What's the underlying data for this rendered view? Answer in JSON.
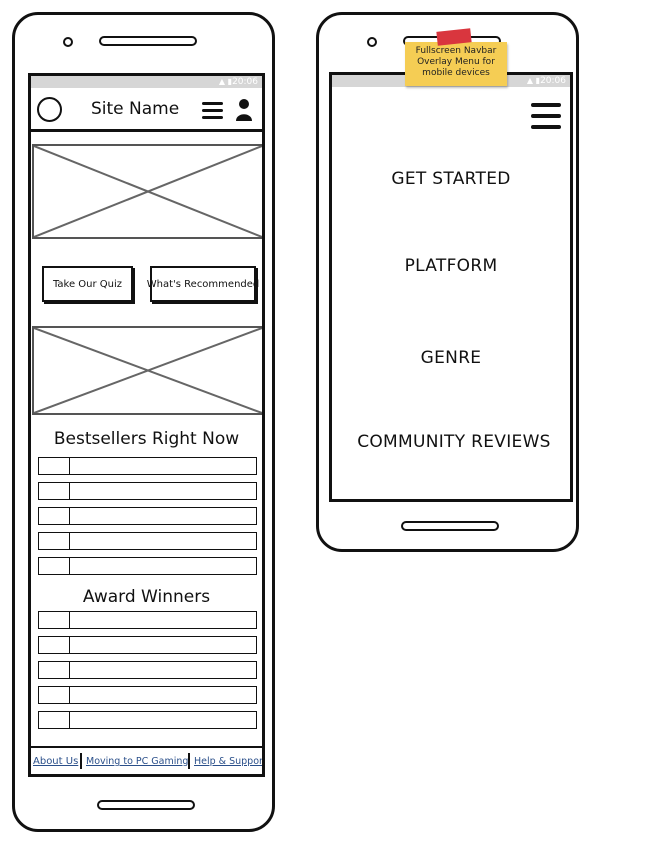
{
  "left_phone": {
    "status_time": "20:06",
    "status_icons": "▲ ▮",
    "header": {
      "site_name": "Site Name",
      "logo_icon": "circle-logo-icon",
      "menu_icon": "hamburger-menu-icon",
      "user_icon": "user-icon"
    },
    "buttons": {
      "quiz": "Take Our Quiz",
      "recommended": "What's Recommended"
    },
    "sections": {
      "bestsellers_title": "Bestsellers Right Now",
      "award_title": "Award Winners"
    },
    "bestseller_rows": 5,
    "award_rows": 5,
    "footer": {
      "about": "About Us",
      "moving": "Moving to PC Gaming",
      "help": "Help & Support"
    }
  },
  "right_phone": {
    "status_time": "20:06",
    "status_icons": "▲ ▮",
    "menu_icon": "hamburger-menu-icon",
    "menu_items": [
      "GET STARTED",
      "PLATFORM",
      "GENRE",
      "COMMUNITY REVIEWS"
    ]
  },
  "annotation": {
    "sticky_note": "Fullscreen Navbar Overlay Menu for mobile devices",
    "sticky_color": "#f5cd54",
    "tape_color": "#d9363e"
  },
  "colors": {
    "status_bar": "#d6d6d6",
    "footer_link": "#2a4f8a"
  }
}
